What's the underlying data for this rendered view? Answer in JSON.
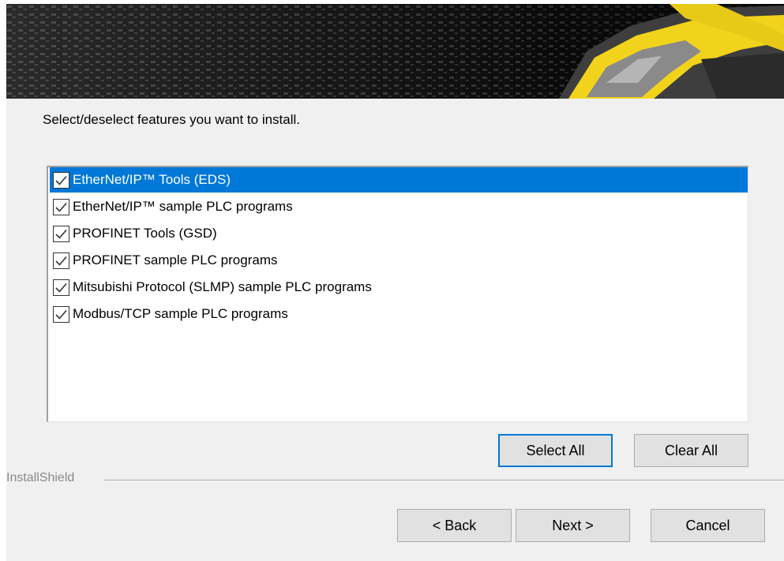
{
  "banner": {
    "image": "barcode-scanner-graphic"
  },
  "instruction": "Select/deselect features you want to install.",
  "features": [
    {
      "label": "EtherNet/IP™ Tools (EDS)",
      "checked": true,
      "selected": true
    },
    {
      "label": "EtherNet/IP™ sample PLC programs",
      "checked": true,
      "selected": false
    },
    {
      "label": "PROFINET Tools (GSD)",
      "checked": true,
      "selected": false
    },
    {
      "label": "PROFINET sample PLC programs",
      "checked": true,
      "selected": false
    },
    {
      "label": "Mitsubishi Protocol (SLMP) sample PLC programs",
      "checked": true,
      "selected": false
    },
    {
      "label": "Modbus/TCP sample PLC programs",
      "checked": true,
      "selected": false
    }
  ],
  "buttons": {
    "select_all": "Select All",
    "clear_all": "Clear All",
    "back": "< Back",
    "next": "Next >",
    "cancel": "Cancel"
  },
  "footer": {
    "group_label": "InstallShield"
  },
  "colors": {
    "selection": "#0078d7",
    "panel": "#f0f0f0",
    "accent_yellow": "#f2d31b"
  }
}
